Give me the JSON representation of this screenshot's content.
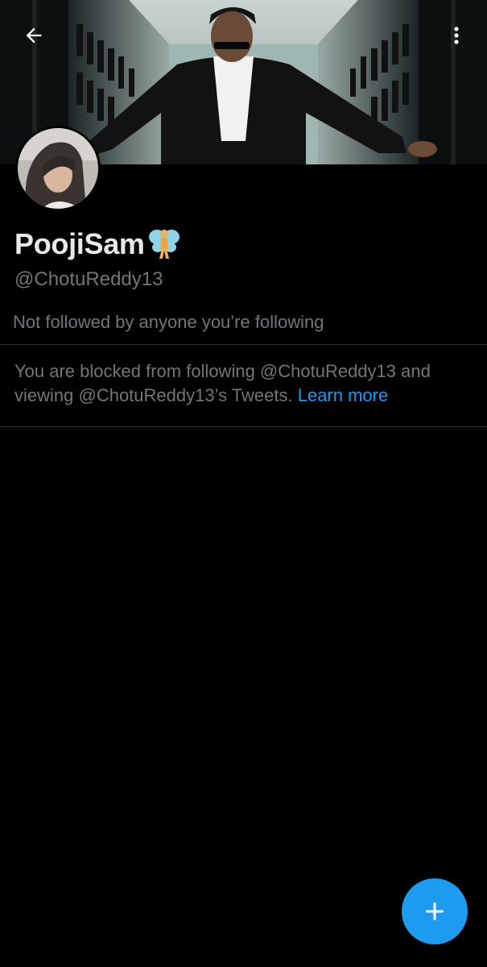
{
  "profile": {
    "display_name": "PoojiSam",
    "name_emoji_icon": "fairy-emoji-icon",
    "handle": "@ChotuReddy13",
    "followed_note": "Not followed by anyone you’re following"
  },
  "blocked_notice": {
    "text": "You are blocked from following @ChotuReddy13 and viewing @ChotuReddy13’s Tweets.",
    "link_label": "Learn more"
  },
  "header": {
    "back_icon": "back-arrow-icon",
    "more_icon": "more-vertical-icon"
  },
  "fab": {
    "icon": "plus-icon"
  },
  "colors": {
    "background": "#000000",
    "primary_text": "#e7e9ea",
    "secondary_text": "#71767b",
    "accent": "#1d9bf0",
    "divider": "#2f3336"
  }
}
